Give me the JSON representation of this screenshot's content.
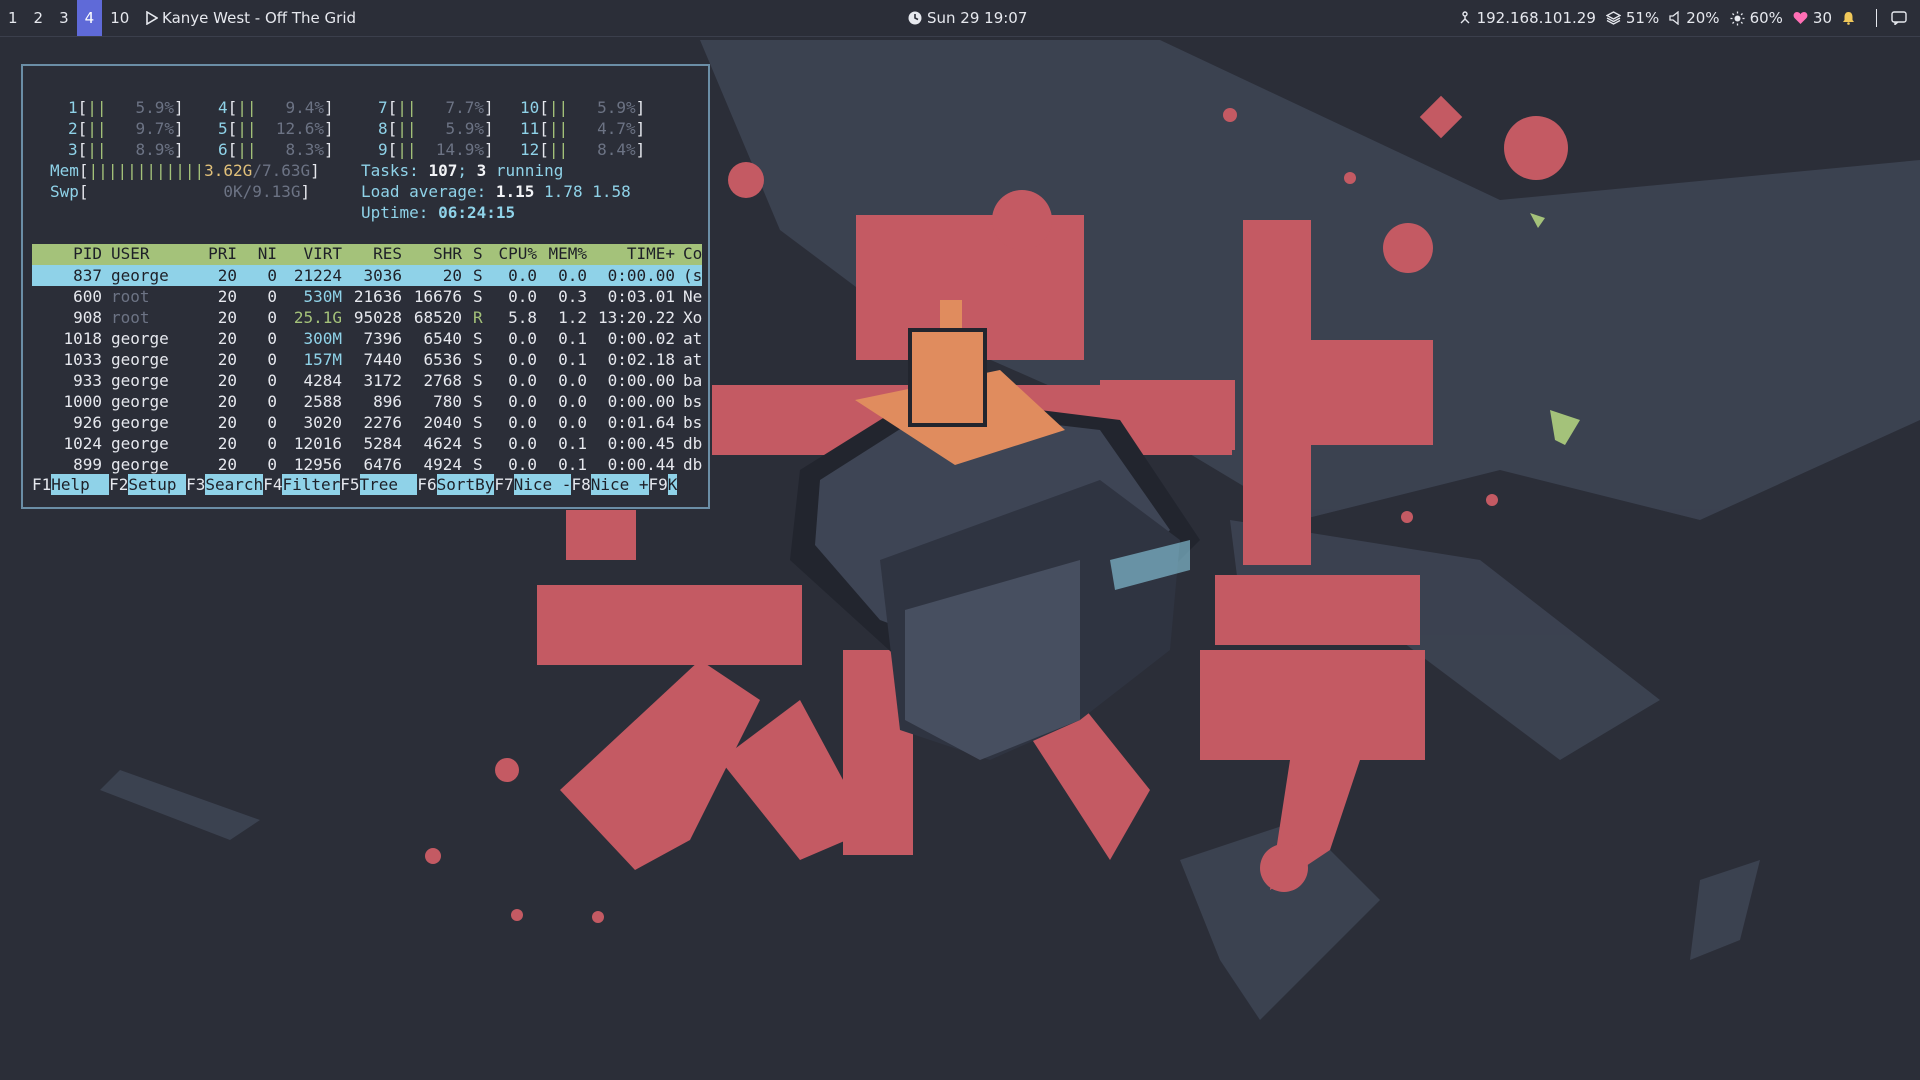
{
  "topbar": {
    "workspaces": [
      {
        "label": "1",
        "active": false
      },
      {
        "label": "2",
        "active": false
      },
      {
        "label": "3",
        "active": false
      },
      {
        "label": "4",
        "active": true
      },
      {
        "label": "10",
        "active": false
      }
    ],
    "now_playing": "Kanye West - Off The Grid",
    "clock": "Sun 29 19:07",
    "ip": "192.168.101.29",
    "disk": "51%",
    "volume": "20%",
    "brightness": "60%",
    "heart": "30",
    "accent": "#5f6ad8"
  },
  "htop": {
    "cpus": [
      {
        "num": "1",
        "bar": "||",
        "pct": "5.9%"
      },
      {
        "num": "2",
        "bar": "||",
        "pct": "9.7%"
      },
      {
        "num": "3",
        "bar": "||",
        "pct": "8.9%"
      },
      {
        "num": "4",
        "bar": "||",
        "pct": "9.4%"
      },
      {
        "num": "5",
        "bar": "||",
        "pct": "12.6%"
      },
      {
        "num": "6",
        "bar": "||",
        "pct": "8.3%"
      },
      {
        "num": "7",
        "bar": "||",
        "pct": "7.7%"
      },
      {
        "num": "8",
        "bar": "||",
        "pct": "5.9%"
      },
      {
        "num": "9",
        "bar": "||",
        "pct": "14.9%"
      },
      {
        "num": "10",
        "bar": "||",
        "pct": "5.9%"
      },
      {
        "num": "11",
        "bar": "||",
        "pct": "4.7%"
      },
      {
        "num": "12",
        "bar": "||",
        "pct": "8.4%"
      }
    ],
    "mem": {
      "label": "Mem",
      "bar": "||||||||||||",
      "used": "3.62G",
      "total": "/7.63G"
    },
    "swp": {
      "label": "Swp",
      "value": "0K/9.13G"
    },
    "tasks": {
      "label": "Tasks:",
      "count": "107",
      "sep": ";",
      "running": "3",
      "running_label": "running"
    },
    "load": {
      "label": "Load average:",
      "v1": "1.15",
      "v5": "1.78",
      "v15": "1.58"
    },
    "uptime": {
      "label": "Uptime:",
      "value": "06:24:15"
    },
    "columns": [
      "PID",
      "USER",
      "PRI",
      "NI",
      "VIRT",
      "RES",
      "SHR",
      "S",
      "CPU%",
      "MEM%",
      "TIME+",
      "Co"
    ],
    "processes": [
      {
        "pid": "837",
        "user": "george",
        "pri": "20",
        "ni": "0",
        "virt": "21224",
        "res": "3036",
        "shr": "20",
        "s": "S",
        "cpu": "0.0",
        "mem": "0.0",
        "time": "0:00.00",
        "cmd": "(s"
      },
      {
        "pid": "600",
        "user": "root",
        "pri": "20",
        "ni": "0",
        "virt": "530M",
        "res": "21636",
        "shr": "16676",
        "s": "S",
        "cpu": "0.0",
        "mem": "0.3",
        "time": "0:03.01",
        "cmd": "Ne"
      },
      {
        "pid": "908",
        "user": "root",
        "pri": "20",
        "ni": "0",
        "virt": "25.1G",
        "res": "95028",
        "shr": "68520",
        "s": "R",
        "cpu": "5.8",
        "mem": "1.2",
        "time": "13:20.22",
        "cmd": "Xo"
      },
      {
        "pid": "1018",
        "user": "george",
        "pri": "20",
        "ni": "0",
        "virt": "300M",
        "res": "7396",
        "shr": "6540",
        "s": "S",
        "cpu": "0.0",
        "mem": "0.1",
        "time": "0:00.02",
        "cmd": "at"
      },
      {
        "pid": "1033",
        "user": "george",
        "pri": "20",
        "ni": "0",
        "virt": "157M",
        "res": "7440",
        "shr": "6536",
        "s": "S",
        "cpu": "0.0",
        "mem": "0.1",
        "time": "0:02.18",
        "cmd": "at"
      },
      {
        "pid": "933",
        "user": "george",
        "pri": "20",
        "ni": "0",
        "virt": "4284",
        "res": "3172",
        "shr": "2768",
        "s": "S",
        "cpu": "0.0",
        "mem": "0.0",
        "time": "0:00.00",
        "cmd": "ba"
      },
      {
        "pid": "1000",
        "user": "george",
        "pri": "20",
        "ni": "0",
        "virt": "2588",
        "res": "896",
        "shr": "780",
        "s": "S",
        "cpu": "0.0",
        "mem": "0.0",
        "time": "0:00.00",
        "cmd": "bs"
      },
      {
        "pid": "926",
        "user": "george",
        "pri": "20",
        "ni": "0",
        "virt": "3020",
        "res": "2276",
        "shr": "2040",
        "s": "S",
        "cpu": "0.0",
        "mem": "0.0",
        "time": "0:01.64",
        "cmd": "bs"
      },
      {
        "pid": "1024",
        "user": "george",
        "pri": "20",
        "ni": "0",
        "virt": "12016",
        "res": "5284",
        "shr": "4624",
        "s": "S",
        "cpu": "0.0",
        "mem": "0.1",
        "time": "0:00.45",
        "cmd": "db"
      },
      {
        "pid": "899",
        "user": "george",
        "pri": "20",
        "ni": "0",
        "virt": "12956",
        "res": "6476",
        "shr": "4924",
        "s": "S",
        "cpu": "0.0",
        "mem": "0.1",
        "time": "0:00.44",
        "cmd": "db"
      }
    ],
    "fkeys": [
      {
        "key": "F1",
        "label": "Help  "
      },
      {
        "key": "F2",
        "label": "Setup "
      },
      {
        "key": "F3",
        "label": "Search"
      },
      {
        "key": "F4",
        "label": "Filter"
      },
      {
        "key": "F5",
        "label": "Tree  "
      },
      {
        "key": "F6",
        "label": "SortBy"
      },
      {
        "key": "F7",
        "label": "Nice -"
      },
      {
        "key": "F8",
        "label": "Nice +"
      },
      {
        "key": "F9",
        "label": "K"
      }
    ]
  },
  "wallpaper": {
    "subject": "keyboard switch illustration with katakana",
    "katakana_top": "ポート",
    "katakana_bottom": "スイッチ",
    "colors": {
      "red": "#c45a63",
      "orange": "#e08c5e",
      "dark": "#22252e",
      "shadow": "#3e4555"
    }
  }
}
